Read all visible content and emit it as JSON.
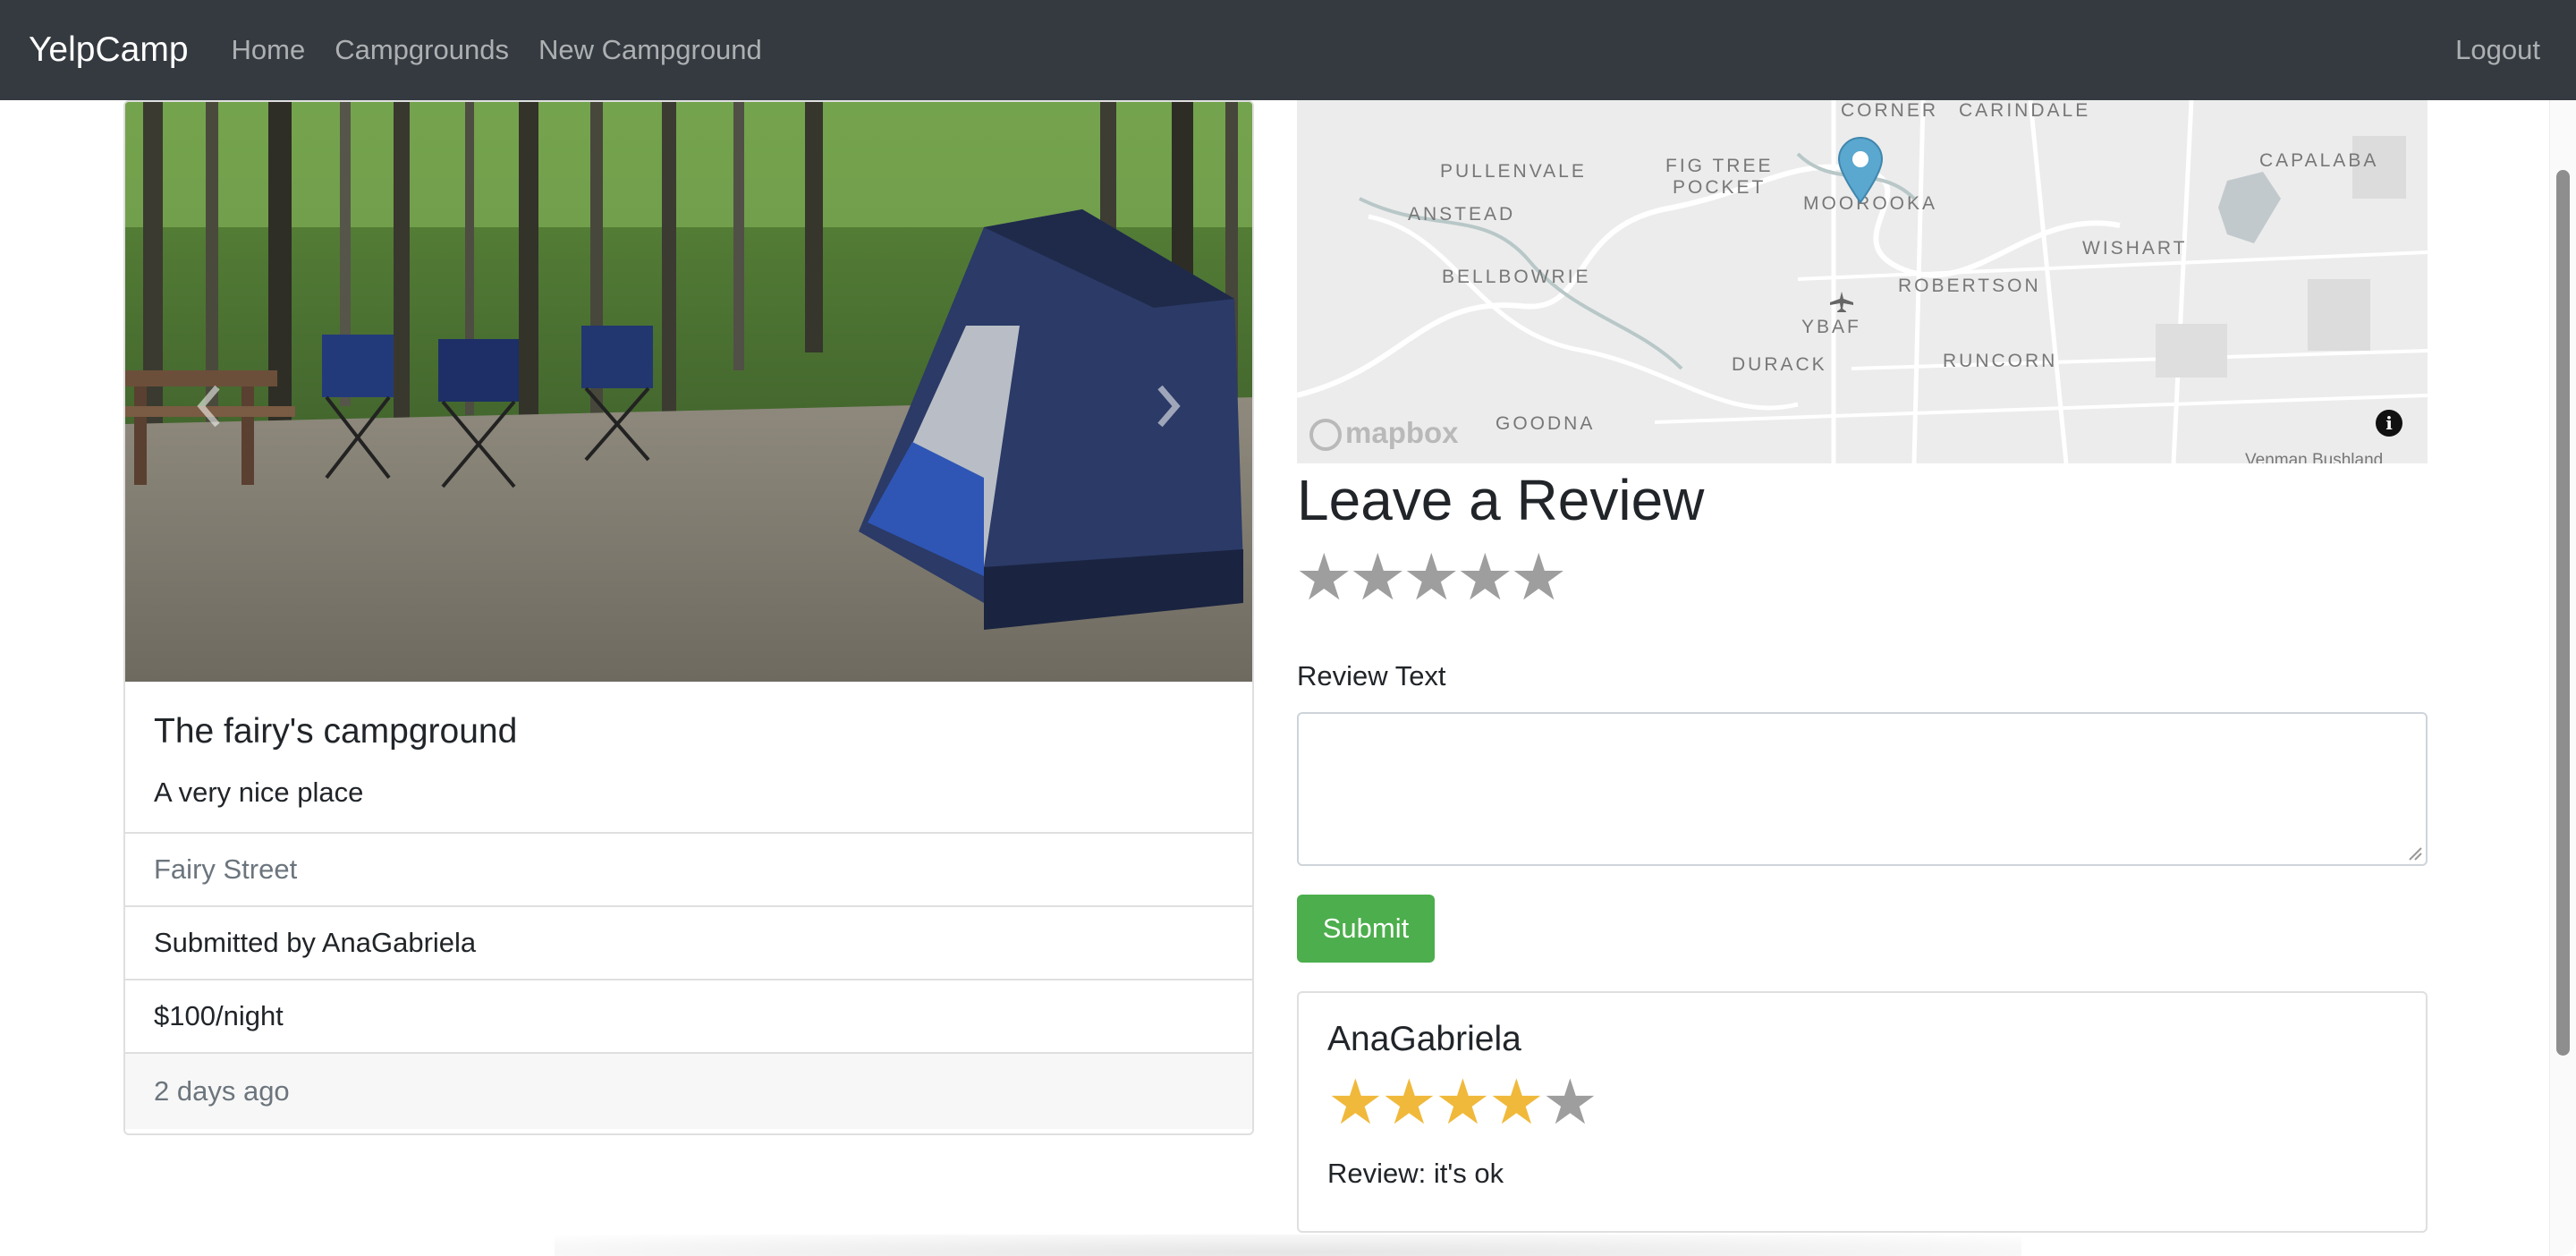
{
  "navbar": {
    "brand": "YelpCamp",
    "links": [
      "Home",
      "Campgrounds",
      "New Campground"
    ],
    "logout": "Logout"
  },
  "campground": {
    "title": "The fairy's campground",
    "description": "A very nice place",
    "location": "Fairy Street",
    "submitted_by": "Submitted by AnaGabriela",
    "price": "$100/night",
    "posted": "2 days ago"
  },
  "map": {
    "labels": [
      "CORNER",
      "CARINDALE",
      "PULLENVALE",
      "FIG TREE",
      "POCKET",
      "MOOROOKA",
      "CAPALABA",
      "ANSTEAD",
      "WISHART",
      "BELLBOWRIE",
      "ROBERTSON",
      "YBAF",
      "DURACK",
      "RUNCORN",
      "GOODNA",
      "Venman Bushland"
    ],
    "logo": "mapbox",
    "info": "i"
  },
  "review_form": {
    "heading": "Leave a Review",
    "rating_icon": "star-icon",
    "rating_options": 5,
    "text_label": "Review Text",
    "submit": "Submit"
  },
  "reviews": [
    {
      "author": "AnaGabriela",
      "rating": 4,
      "max_rating": 5,
      "text": "Review: it's ok"
    }
  ],
  "colors": {
    "navbar": "#343a40",
    "submit": "#4cae4c",
    "star_filled": "#f0b93b",
    "star_empty": "#9e9e9e",
    "map_pin": "#5aa7cf"
  }
}
